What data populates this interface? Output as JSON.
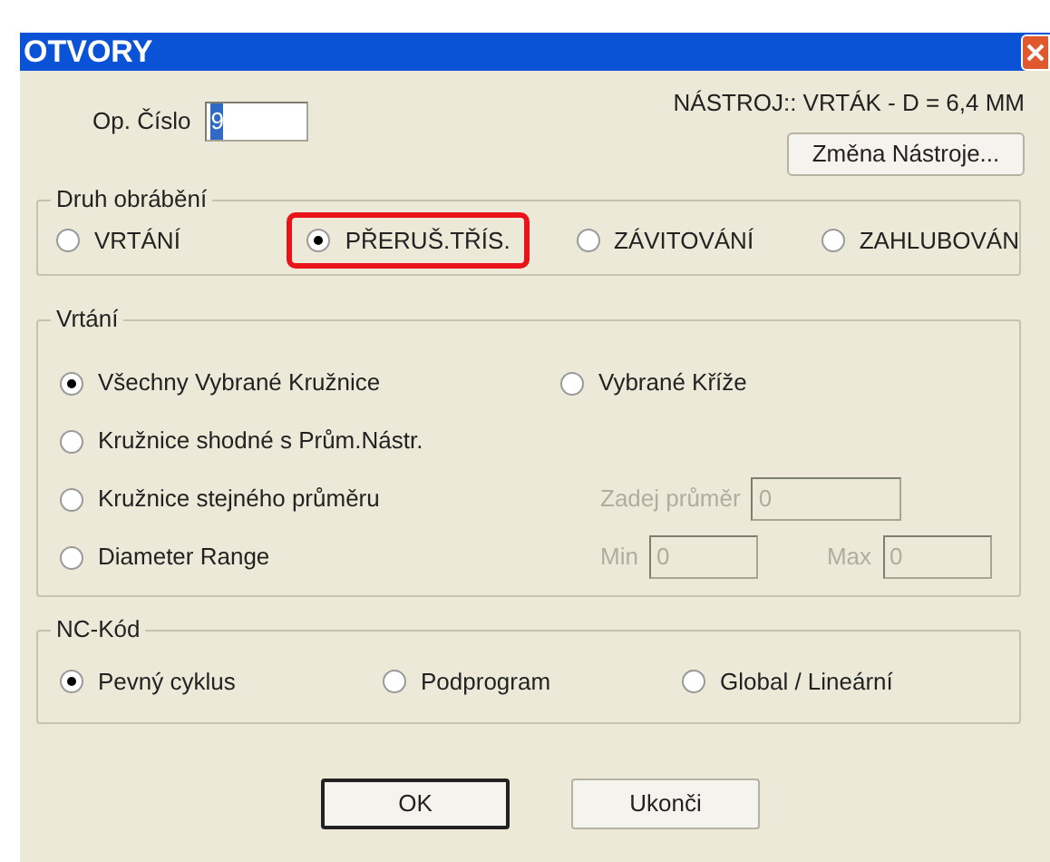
{
  "window": {
    "title": "OTVORY"
  },
  "op_cislo": {
    "label": "Op. Číslo",
    "value": "9",
    "text_selected": true
  },
  "tool_info": "NÁSTROJ:: VRTÁK - D = 6,4 MM",
  "change_tool_button": "Změna Nástroje...",
  "druh_obrabeni": {
    "title": "Druh obrábění",
    "options": [
      {
        "label": "VRTÁNÍ",
        "selected": false,
        "highlighted": false
      },
      {
        "label": "PŘERUŠ.TŘÍS.",
        "selected": true,
        "highlighted": true
      },
      {
        "label": "ZÁVITOVÁNÍ",
        "selected": false,
        "highlighted": false
      },
      {
        "label": "ZAHLUBOVÁN",
        "selected": false,
        "highlighted": false
      }
    ]
  },
  "vrtani": {
    "title": "Vrtání",
    "options": [
      {
        "label": "Všechny Vybrané Kružnice",
        "selected": true
      },
      {
        "label": "Vybrané Kříže",
        "selected": false
      },
      {
        "label": "Kružnice shodné s Prům.Nástr.",
        "selected": false
      },
      {
        "label": "Kružnice stejného průměru",
        "selected": false
      },
      {
        "label": "Diameter Range",
        "selected": false
      }
    ],
    "diameter": {
      "label": "Zadej průměr",
      "value": "0",
      "disabled": true
    },
    "min": {
      "label": "Min",
      "value": "0",
      "disabled": true
    },
    "max": {
      "label": "Max",
      "value": "0",
      "disabled": true
    }
  },
  "nc_kod": {
    "title": "NC-Kód",
    "options": [
      {
        "label": "Pevný cyklus",
        "selected": true
      },
      {
        "label": "Podprogram",
        "selected": false
      },
      {
        "label": "Global / Lineární",
        "selected": false
      }
    ]
  },
  "buttons": [
    {
      "label": "OK",
      "default": true
    },
    {
      "label": "Ukonči",
      "default": false
    }
  ]
}
